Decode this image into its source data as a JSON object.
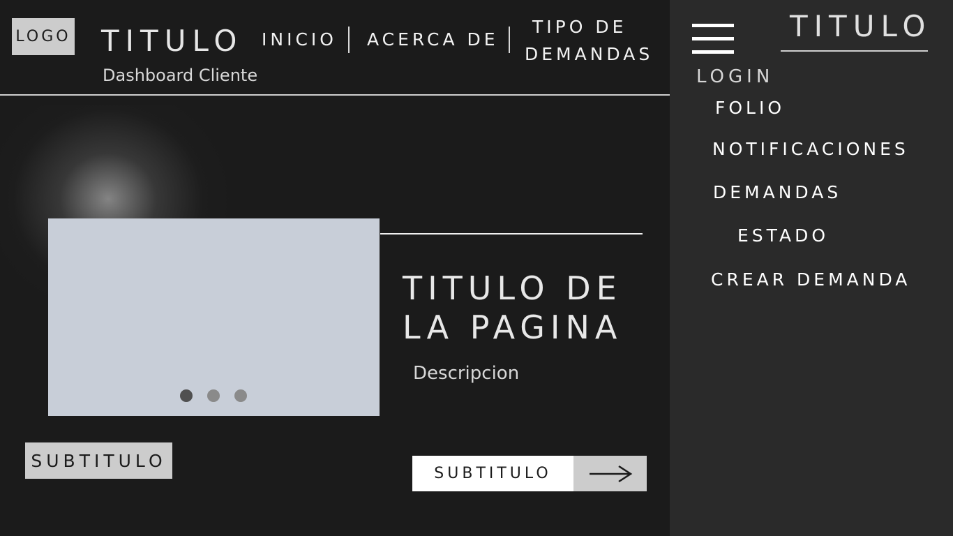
{
  "header": {
    "logo": "LOGO",
    "title": "TITULO",
    "subtitle": "Dashboard Cliente",
    "nav": [
      "INICIO",
      "ACERCA DE"
    ],
    "nav_tipo": {
      "line1": "TIPO DE",
      "line2": "DEMANDAS"
    }
  },
  "hero": {
    "title_line1": "TITULO DE",
    "title_line2": "LA PAGINA",
    "description": "Descripcion",
    "dots_colors": [
      "#505050",
      "#8a8a8a",
      "#8a8a8a"
    ]
  },
  "buttons": {
    "subtitle_left": "SUBTITULO",
    "subtitle_right": "SUBTITULO"
  },
  "sidebar": {
    "title": "TITULO",
    "login": "LOGIN",
    "items": [
      "FOLIO",
      "NOTIFICACIONES",
      "DEMANDAS",
      "ESTADO",
      "CREAR DEMANDA"
    ]
  },
  "icons": {
    "menu": "hamburger-icon",
    "arrow": "arrow-right-icon"
  },
  "colors": {
    "background": "#1b1b1b",
    "sidebar": "#2a2a2a",
    "image_placeholder": "#c8ced8",
    "button_gray": "#cccccc"
  }
}
